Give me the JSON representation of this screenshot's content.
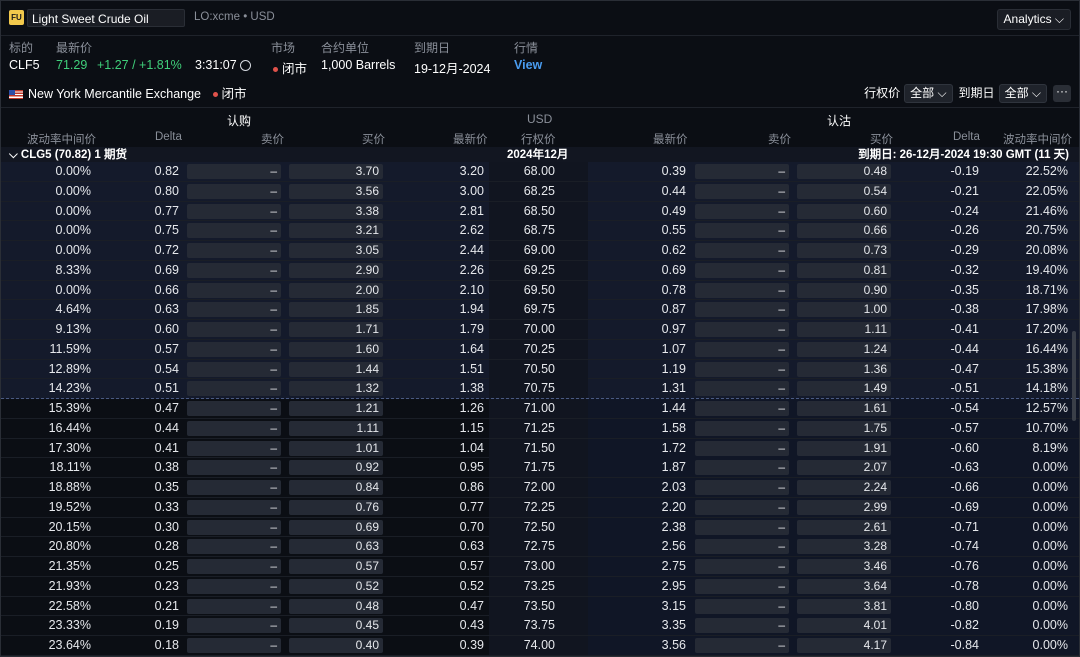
{
  "header": {
    "logo_text": "FU",
    "symbol_name": "Light Sweet Crude Oil",
    "symbol_meta": "LO:xcme • USD",
    "analytics_label": "Analytics ⌵"
  },
  "info": {
    "labels": {
      "symbol": "标的",
      "last": "最新价",
      "market": "市场",
      "unit": "合约单位",
      "expiry": "到期日",
      "quote": "行情"
    },
    "symbol": "CLF5",
    "last_price": "71.29",
    "change": "+1.27 / +1.81%",
    "time": "3:31:07",
    "market_status": "闭市",
    "unit": "1,000 Barrels",
    "expiry": "19-12月-2024",
    "quote_link": "View"
  },
  "exchange": {
    "name": "New York Mercantile Exchange",
    "status": "闭市",
    "strike_filter_label": "行权价",
    "strike_filter_value": "全部 ⌵",
    "expiry_filter_label": "到期日",
    "expiry_filter_value": "全部 ⌵",
    "more": "···"
  },
  "groups": {
    "calls": "认购",
    "center": "USD",
    "puts": "认沽"
  },
  "columns": {
    "iv": "波动率中间价",
    "delta": "Delta",
    "bid": "卖价",
    "ask": "买价",
    "last": "最新价",
    "strike": "行权价",
    "p_last": "最新价",
    "p_bid": "卖价",
    "p_ask": "买价",
    "p_delta": "Delta",
    "p_iv": "波动率中间价"
  },
  "contract": {
    "name": "⌵ CLG5 (70.82) 1 期货",
    "month": "2024年12月",
    "expiry_text": "到期日: 26-12月-2024 19:30 GMT (11 天)"
  },
  "rows": [
    {
      "civ": "0.00%",
      "cd": "0.82",
      "cb": "–",
      "ca": "3.70",
      "cl": "3.20",
      "k": "68.00",
      "pl": "0.39",
      "pb": "–",
      "pa": "0.48",
      "pd": "-0.19",
      "piv": "22.52%"
    },
    {
      "civ": "0.00%",
      "cd": "0.80",
      "cb": "–",
      "ca": "3.56",
      "cl": "3.00",
      "k": "68.25",
      "pl": "0.44",
      "pb": "–",
      "pa": "0.54",
      "pd": "-0.21",
      "piv": "22.05%"
    },
    {
      "civ": "0.00%",
      "cd": "0.77",
      "cb": "–",
      "ca": "3.38",
      "cl": "2.81",
      "k": "68.50",
      "pl": "0.49",
      "pb": "–",
      "pa": "0.60",
      "pd": "-0.24",
      "piv": "21.46%"
    },
    {
      "civ": "0.00%",
      "cd": "0.75",
      "cb": "–",
      "ca": "3.21",
      "cl": "2.62",
      "k": "68.75",
      "pl": "0.55",
      "pb": "–",
      "pa": "0.66",
      "pd": "-0.26",
      "piv": "20.75%"
    },
    {
      "civ": "0.00%",
      "cd": "0.72",
      "cb": "–",
      "ca": "3.05",
      "cl": "2.44",
      "k": "69.00",
      "pl": "0.62",
      "pb": "–",
      "pa": "0.73",
      "pd": "-0.29",
      "piv": "20.08%"
    },
    {
      "civ": "8.33%",
      "cd": "0.69",
      "cb": "–",
      "ca": "2.90",
      "cl": "2.26",
      "k": "69.25",
      "pl": "0.69",
      "pb": "–",
      "pa": "0.81",
      "pd": "-0.32",
      "piv": "19.40%"
    },
    {
      "civ": "0.00%",
      "cd": "0.66",
      "cb": "–",
      "ca": "2.00",
      "cl": "2.10",
      "k": "69.50",
      "pl": "0.78",
      "pb": "–",
      "pa": "0.90",
      "pd": "-0.35",
      "piv": "18.71%"
    },
    {
      "civ": "4.64%",
      "cd": "0.63",
      "cb": "–",
      "ca": "1.85",
      "cl": "1.94",
      "k": "69.75",
      "pl": "0.87",
      "pb": "–",
      "pa": "1.00",
      "pd": "-0.38",
      "piv": "17.98%"
    },
    {
      "civ": "9.13%",
      "cd": "0.60",
      "cb": "–",
      "ca": "1.71",
      "cl": "1.79",
      "k": "70.00",
      "pl": "0.97",
      "pb": "–",
      "pa": "1.11",
      "pd": "-0.41",
      "piv": "17.20%"
    },
    {
      "civ": "11.59%",
      "cd": "0.57",
      "cb": "–",
      "ca": "1.60",
      "cl": "1.64",
      "k": "70.25",
      "pl": "1.07",
      "pb": "–",
      "pa": "1.24",
      "pd": "-0.44",
      "piv": "16.44%"
    },
    {
      "civ": "12.89%",
      "cd": "0.54",
      "cb": "–",
      "ca": "1.44",
      "cl": "1.51",
      "k": "70.50",
      "pl": "1.19",
      "pb": "–",
      "pa": "1.36",
      "pd": "-0.47",
      "piv": "15.38%"
    },
    {
      "civ": "14.23%",
      "cd": "0.51",
      "cb": "–",
      "ca": "1.32",
      "cl": "1.38",
      "k": "70.75",
      "pl": "1.31",
      "pb": "–",
      "pa": "1.49",
      "pd": "-0.51",
      "piv": "14.18%"
    },
    {
      "civ": "15.39%",
      "cd": "0.47",
      "cb": "–",
      "ca": "1.21",
      "cl": "1.26",
      "k": "71.00",
      "pl": "1.44",
      "pb": "–",
      "pa": "1.61",
      "pd": "-0.54",
      "piv": "12.57%"
    },
    {
      "civ": "16.44%",
      "cd": "0.44",
      "cb": "–",
      "ca": "1.11",
      "cl": "1.15",
      "k": "71.25",
      "pl": "1.58",
      "pb": "–",
      "pa": "1.75",
      "pd": "-0.57",
      "piv": "10.70%"
    },
    {
      "civ": "17.30%",
      "cd": "0.41",
      "cb": "–",
      "ca": "1.01",
      "cl": "1.04",
      "k": "71.50",
      "pl": "1.72",
      "pb": "–",
      "pa": "1.91",
      "pd": "-0.60",
      "piv": "8.19%"
    },
    {
      "civ": "18.11%",
      "cd": "0.38",
      "cb": "–",
      "ca": "0.92",
      "cl": "0.95",
      "k": "71.75",
      "pl": "1.87",
      "pb": "–",
      "pa": "2.07",
      "pd": "-0.63",
      "piv": "0.00%"
    },
    {
      "civ": "18.88%",
      "cd": "0.35",
      "cb": "–",
      "ca": "0.84",
      "cl": "0.86",
      "k": "72.00",
      "pl": "2.03",
      "pb": "–",
      "pa": "2.24",
      "pd": "-0.66",
      "piv": "0.00%"
    },
    {
      "civ": "19.52%",
      "cd": "0.33",
      "cb": "–",
      "ca": "0.76",
      "cl": "0.77",
      "k": "72.25",
      "pl": "2.20",
      "pb": "–",
      "pa": "2.99",
      "pd": "-0.69",
      "piv": "0.00%"
    },
    {
      "civ": "20.15%",
      "cd": "0.30",
      "cb": "–",
      "ca": "0.69",
      "cl": "0.70",
      "k": "72.50",
      "pl": "2.38",
      "pb": "–",
      "pa": "2.61",
      "pd": "-0.71",
      "piv": "0.00%"
    },
    {
      "civ": "20.80%",
      "cd": "0.28",
      "cb": "–",
      "ca": "0.63",
      "cl": "0.63",
      "k": "72.75",
      "pl": "2.56",
      "pb": "–",
      "pa": "3.28",
      "pd": "-0.74",
      "piv": "0.00%"
    },
    {
      "civ": "21.35%",
      "cd": "0.25",
      "cb": "–",
      "ca": "0.57",
      "cl": "0.57",
      "k": "73.00",
      "pl": "2.75",
      "pb": "–",
      "pa": "3.46",
      "pd": "-0.76",
      "piv": "0.00%"
    },
    {
      "civ": "21.93%",
      "cd": "0.23",
      "cb": "–",
      "ca": "0.52",
      "cl": "0.52",
      "k": "73.25",
      "pl": "2.95",
      "pb": "–",
      "pa": "3.64",
      "pd": "-0.78",
      "piv": "0.00%"
    },
    {
      "civ": "22.58%",
      "cd": "0.21",
      "cb": "–",
      "ca": "0.48",
      "cl": "0.47",
      "k": "73.50",
      "pl": "3.15",
      "pb": "–",
      "pa": "3.81",
      "pd": "-0.80",
      "piv": "0.00%"
    },
    {
      "civ": "23.33%",
      "cd": "0.19",
      "cb": "–",
      "ca": "0.45",
      "cl": "0.43",
      "k": "73.75",
      "pl": "3.35",
      "pb": "–",
      "pa": "4.01",
      "pd": "-0.82",
      "piv": "0.00%"
    },
    {
      "civ": "23.64%",
      "cd": "0.18",
      "cb": "–",
      "ca": "0.40",
      "cl": "0.39",
      "k": "74.00",
      "pl": "3.56",
      "pb": "–",
      "pa": "4.17",
      "pd": "-0.84",
      "piv": "0.00%"
    }
  ],
  "itm_call_rows": 12
}
